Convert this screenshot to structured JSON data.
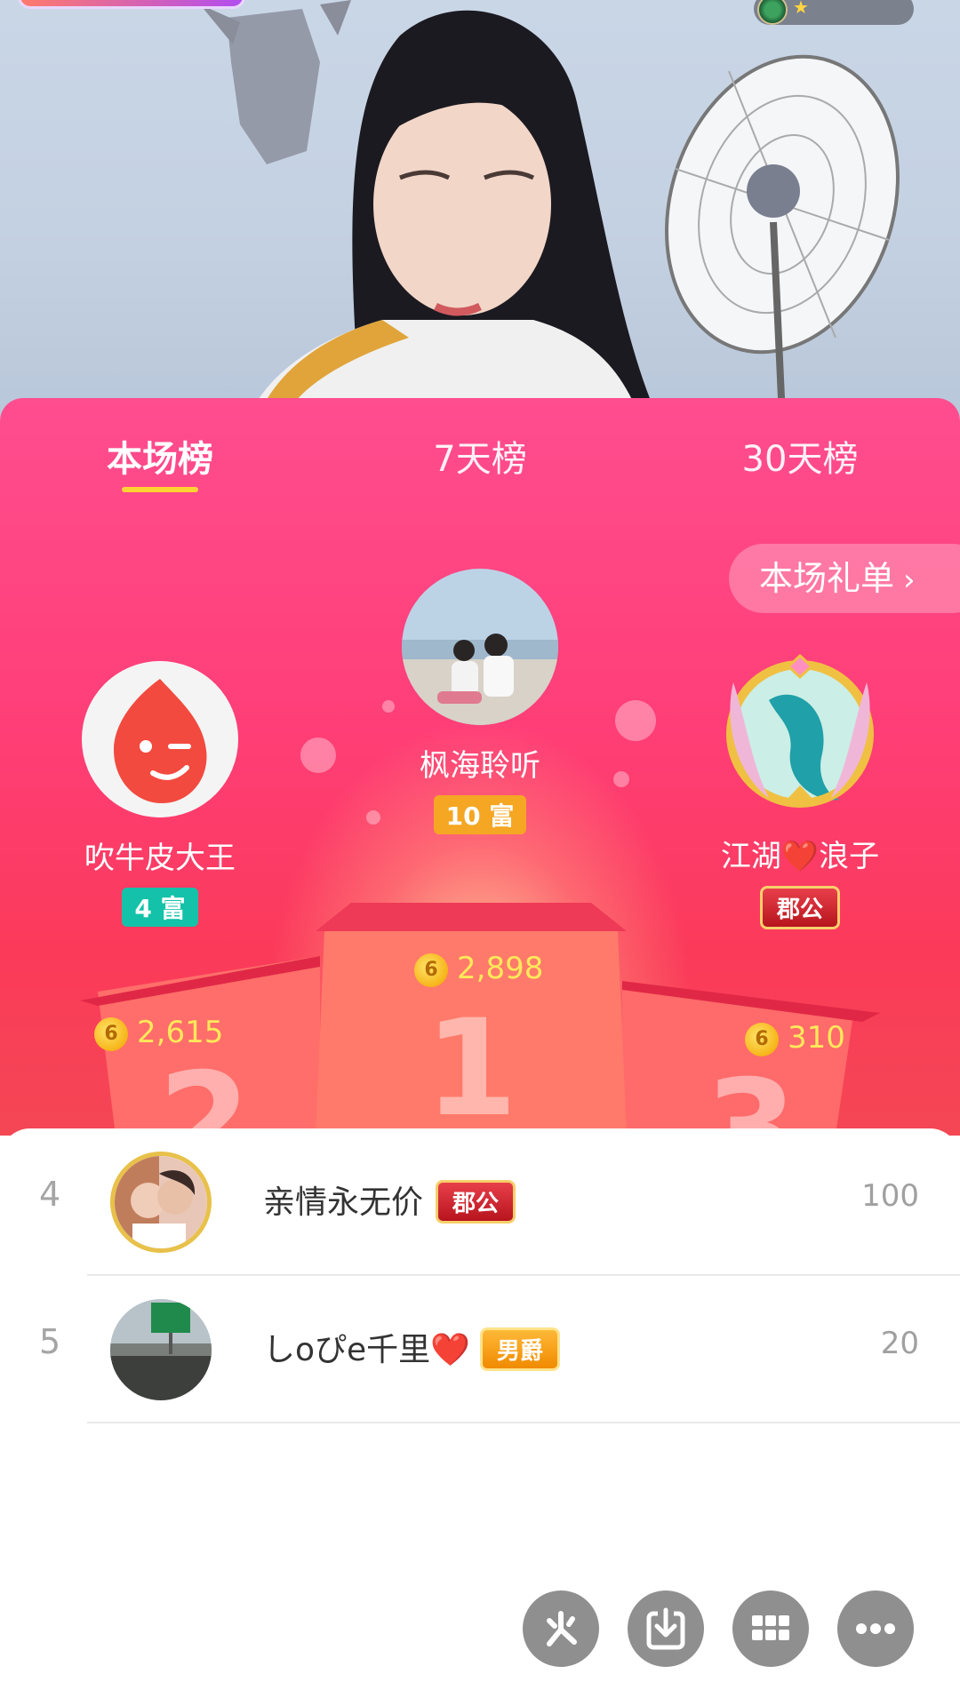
{
  "tabs": [
    {
      "label": "本场榜",
      "active": true
    },
    {
      "label": "7天榜",
      "active": false
    },
    {
      "label": "30天榜",
      "active": false
    }
  ],
  "gift_list_button": {
    "label": "本场礼单",
    "chevron": "›"
  },
  "podium": {
    "first": {
      "rank": "1",
      "name": "枫海聆听",
      "badge": "10 富",
      "score": "2,898",
      "coin_glyph": "6",
      "badge_color": "#f5a623"
    },
    "second": {
      "rank": "2",
      "name": "吹牛皮大王",
      "badge": "4 富",
      "score": "2,615",
      "coin_glyph": "6",
      "badge_color": "#13c2a8"
    },
    "third": {
      "rank": "3",
      "name": "江湖❤️浪子",
      "badge": "郡公",
      "score": "310",
      "coin_glyph": "6"
    }
  },
  "list": [
    {
      "rank": "4",
      "name": "亲情永无价",
      "badge": "郡公",
      "score": "100"
    },
    {
      "rank": "5",
      "name": "しoぴe千里❤️",
      "badge": "男爵",
      "score": "20"
    }
  ],
  "toolbar": {
    "icons": [
      "share-icon",
      "download-icon",
      "grid-icon",
      "more-icon"
    ]
  },
  "colors": {
    "panel_top": "#ff4d8f",
    "panel_bottom": "#f44754",
    "underline": "#ffd234",
    "score_text": "#ffe85a"
  }
}
